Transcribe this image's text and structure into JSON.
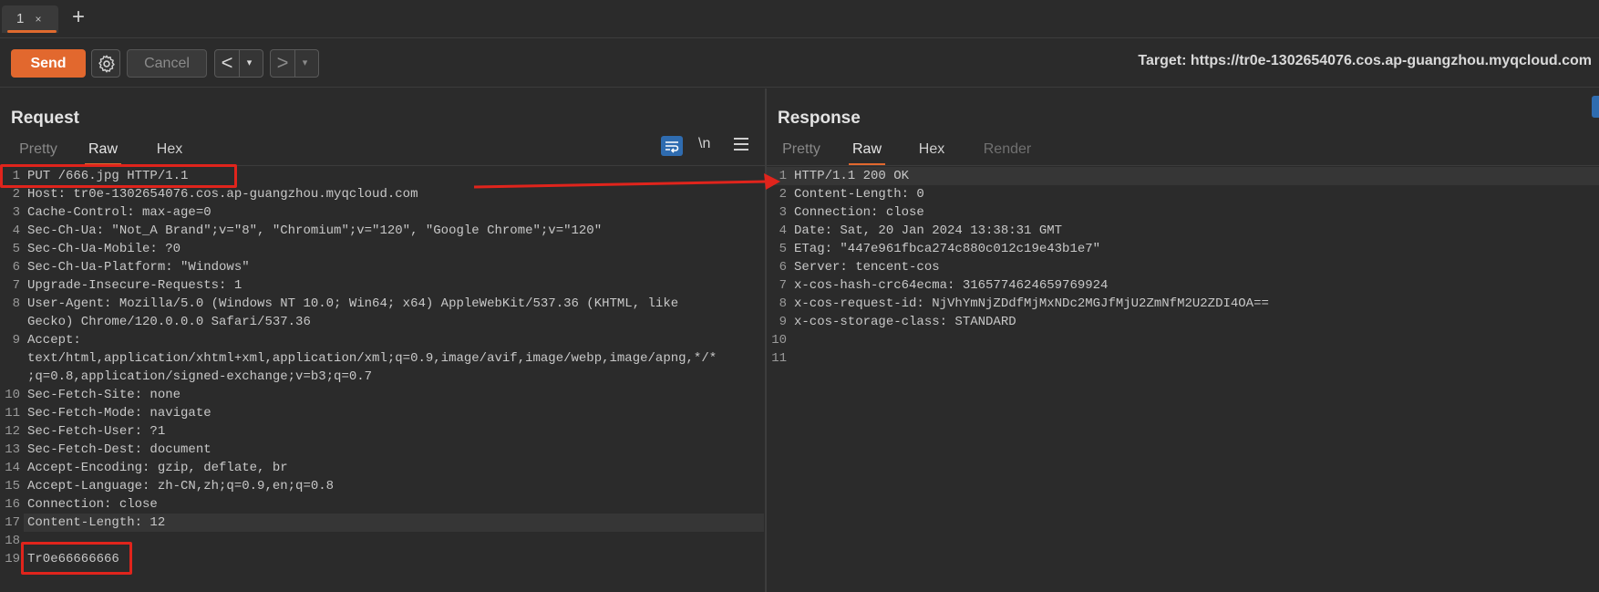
{
  "tabs": [
    {
      "label": "1",
      "close": "×"
    }
  ],
  "add_tab": "+",
  "toolbar": {
    "send": "Send",
    "cancel": "Cancel",
    "back": "<",
    "forward": ">",
    "dropdown": "▾",
    "target_label": "Target: https://tr0e-1302654076.cos.ap-guangzhou.myqcloud.com"
  },
  "request": {
    "title": "Request",
    "tabs": [
      "Pretty",
      "Raw",
      "Hex"
    ],
    "active_tab": "Raw",
    "tools": {
      "newline": "\\n"
    },
    "lines": [
      {
        "n": "1",
        "text": "PUT /666.jpg HTTP/1.1"
      },
      {
        "n": "2",
        "text": "Host: tr0e-1302654076.cos.ap-guangzhou.myqcloud.com"
      },
      {
        "n": "3",
        "text": "Cache-Control: max-age=0"
      },
      {
        "n": "4",
        "text": "Sec-Ch-Ua: \"Not_A Brand\";v=\"8\", \"Chromium\";v=\"120\", \"Google Chrome\";v=\"120\""
      },
      {
        "n": "5",
        "text": "Sec-Ch-Ua-Mobile: ?0"
      },
      {
        "n": "6",
        "text": "Sec-Ch-Ua-Platform: \"Windows\""
      },
      {
        "n": "7",
        "text": "Upgrade-Insecure-Requests: 1"
      },
      {
        "n": "8",
        "text": "User-Agent: Mozilla/5.0 (Windows NT 10.0; Win64; x64) AppleWebKit/537.36 (KHTML, like"
      },
      {
        "n": "",
        "text": "Gecko) Chrome/120.0.0.0 Safari/537.36"
      },
      {
        "n": "9",
        "text": "Accept:"
      },
      {
        "n": "",
        "text": "text/html,application/xhtml+xml,application/xml;q=0.9,image/avif,image/webp,image/apng,*/*"
      },
      {
        "n": "",
        "text": ";q=0.8,application/signed-exchange;v=b3;q=0.7"
      },
      {
        "n": "10",
        "text": "Sec-Fetch-Site: none"
      },
      {
        "n": "11",
        "text": "Sec-Fetch-Mode: navigate"
      },
      {
        "n": "12",
        "text": "Sec-Fetch-User: ?1"
      },
      {
        "n": "13",
        "text": "Sec-Fetch-Dest: document"
      },
      {
        "n": "14",
        "text": "Accept-Encoding: gzip, deflate, br"
      },
      {
        "n": "15",
        "text": "Accept-Language: zh-CN,zh;q=0.9,en;q=0.8"
      },
      {
        "n": "16",
        "text": "Connection: close"
      },
      {
        "n": "17",
        "text": "Content-Length: 12"
      },
      {
        "n": "18",
        "text": ""
      },
      {
        "n": "19",
        "text": "Tr0e66666666"
      }
    ]
  },
  "response": {
    "title": "Response",
    "tabs": [
      "Pretty",
      "Raw",
      "Hex",
      "Render"
    ],
    "active_tab": "Raw",
    "lines": [
      {
        "n": "1",
        "text": "HTTP/1.1 200 OK"
      },
      {
        "n": "2",
        "text": "Content-Length: 0"
      },
      {
        "n": "3",
        "text": "Connection: close"
      },
      {
        "n": "4",
        "text": "Date: Sat, 20 Jan 2024 13:38:31 GMT"
      },
      {
        "n": "5",
        "text": "ETag: \"447e961fbca274c880c012c19e43b1e7\""
      },
      {
        "n": "6",
        "text": "Server: tencent-cos"
      },
      {
        "n": "7",
        "text": "x-cos-hash-crc64ecma: 3165774624659769924"
      },
      {
        "n": "8",
        "text": "x-cos-request-id: NjVhYmNjZDdfMjMxNDc2MGJfMjU2ZmNfM2U2ZDI4OA=="
      },
      {
        "n": "9",
        "text": "x-cos-storage-class: STANDARD"
      },
      {
        "n": "10",
        "text": ""
      },
      {
        "n": "11",
        "text": ""
      }
    ]
  },
  "colors": {
    "accent": "#e2682e",
    "annotation": "#e0241c",
    "wrap_button": "#2f6cb0"
  }
}
